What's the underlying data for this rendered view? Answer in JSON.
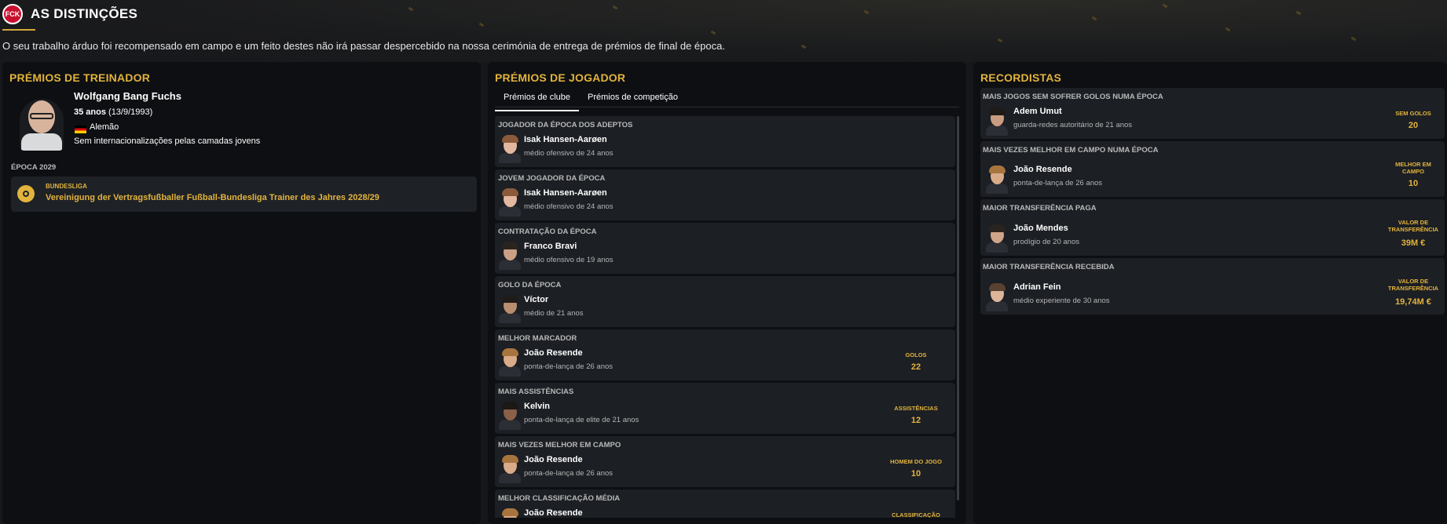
{
  "header": {
    "club_logo_text": "FCK",
    "title": "AS DISTINÇÕES",
    "intro": "O seu trabalho árduo foi recompensado em campo e um feito destes não irá passar despercebido na nossa cerimónia de entrega de prémios de final de época."
  },
  "coach_panel": {
    "title": "PRÉMIOS DE TREINADOR",
    "name": "Wolfgang Bang Fuchs",
    "age": "35 anos",
    "birth": "(13/9/1993)",
    "nationality": "Alemão",
    "youth_caps": "Sem internacionalizações pelas camadas jovens",
    "season": "ÉPOCA 2029",
    "award": {
      "competition": "BUNDESLIGA",
      "name": "Vereinigung der Vertragsfußballer Fußball-Bundesliga Trainer des Jahres 2028/29",
      "icon": "award-medal-icon"
    }
  },
  "player_panel": {
    "title": "PRÉMIOS DE JOGADOR",
    "tabs": [
      "Prémios de clube",
      "Prémios de competição"
    ],
    "active_tab": "Prémios de clube",
    "awards": [
      {
        "title": "JOGADOR DA ÉPOCA DOS ADEPTOS",
        "player": "Isak Hansen-Aarøen",
        "desc": "médio ofensivo de 24 anos",
        "stat_label": "",
        "stat_value": "",
        "hair": "#8a5a3a",
        "skin": "#e3b8a0"
      },
      {
        "title": "JOVEM JOGADOR DA ÉPOCA",
        "player": "Isak Hansen-Aarøen",
        "desc": "médio ofensivo de 24 anos",
        "stat_label": "",
        "stat_value": "",
        "hair": "#8a5a3a",
        "skin": "#e3b8a0"
      },
      {
        "title": "CONTRATAÇÃO DA ÉPOCA",
        "player": "Franco Bravi",
        "desc": "médio ofensivo de 19 anos",
        "stat_label": "",
        "stat_value": "",
        "hair": "#2a2420",
        "skin": "#c9a085"
      },
      {
        "title": "GOLO DA ÉPOCA",
        "player": "Víctor",
        "desc": "médio de 21 anos",
        "stat_label": "",
        "stat_value": "",
        "hair": "#1f1b18",
        "skin": "#b98d70"
      },
      {
        "title": "MELHOR MARCADOR",
        "player": "João Resende",
        "desc": "ponta-de-lança de 26 anos",
        "stat_label": "GOLOS",
        "stat_value": "22",
        "hair": "#a8743e",
        "skin": "#d9ab88"
      },
      {
        "title": "MAIS ASSISTÊNCIAS",
        "player": "Kelvin",
        "desc": "ponta-de-lança de elite de 21 anos",
        "stat_label": "ASSISTÊNCIAS",
        "stat_value": "12",
        "hair": "#1b1816",
        "skin": "#8a6048"
      },
      {
        "title": "MAIS VEZES MELHOR EM CAMPO",
        "player": "João Resende",
        "desc": "ponta-de-lança de 26 anos",
        "stat_label": "HOMEM DO JOGO",
        "stat_value": "10",
        "hair": "#a8743e",
        "skin": "#d9ab88"
      },
      {
        "title": "MELHOR CLASSIFICAÇÃO MÉDIA",
        "player": "João Resende",
        "desc": "",
        "stat_label": "CLASSIFICAÇÃO",
        "stat_value": "",
        "hair": "#a8743e",
        "skin": "#d9ab88"
      }
    ]
  },
  "records_panel": {
    "title": "RECORDISTAS",
    "records": [
      {
        "title": "MAIS JOGOS SEM SOFRER GOLOS NUMA ÉPOCA",
        "player": "Adem Umut",
        "desc": "guarda-redes autoritário de 21 anos",
        "stat_label": "SEM GOLOS",
        "stat_value": "20",
        "hair": "#1e1a17",
        "skin": "#c99c80"
      },
      {
        "title": "MAIS VEZES MELHOR EM CAMPO NUMA ÉPOCA",
        "player": "João Resende",
        "desc": "ponta-de-lança de 26 anos",
        "stat_label": "MELHOR EM CAMPO",
        "stat_value": "10",
        "hair": "#a8743e",
        "skin": "#d9ab88"
      },
      {
        "title": "MAIOR TRANSFERÊNCIA PAGA",
        "player": "João Mendes",
        "desc": "prodígio de 20 anos",
        "stat_label": "VALOR DE TRANSFERÊNCIA",
        "stat_value": "39M €",
        "hair": "#2a2420",
        "skin": "#cfa58a"
      },
      {
        "title": "MAIOR TRANSFERÊNCIA RECEBIDA",
        "player": "Adrian Fein",
        "desc": "médio experiente de 30 anos",
        "stat_label": "VALOR DE TRANSFERÊNCIA",
        "stat_value": "19,74M €",
        "hair": "#5a4030",
        "skin": "#dcb59a"
      }
    ]
  },
  "colors": {
    "accent_gold": "#e2b33d",
    "panel_bg": "#0d0f12",
    "card_bg": "#1c1f24"
  }
}
